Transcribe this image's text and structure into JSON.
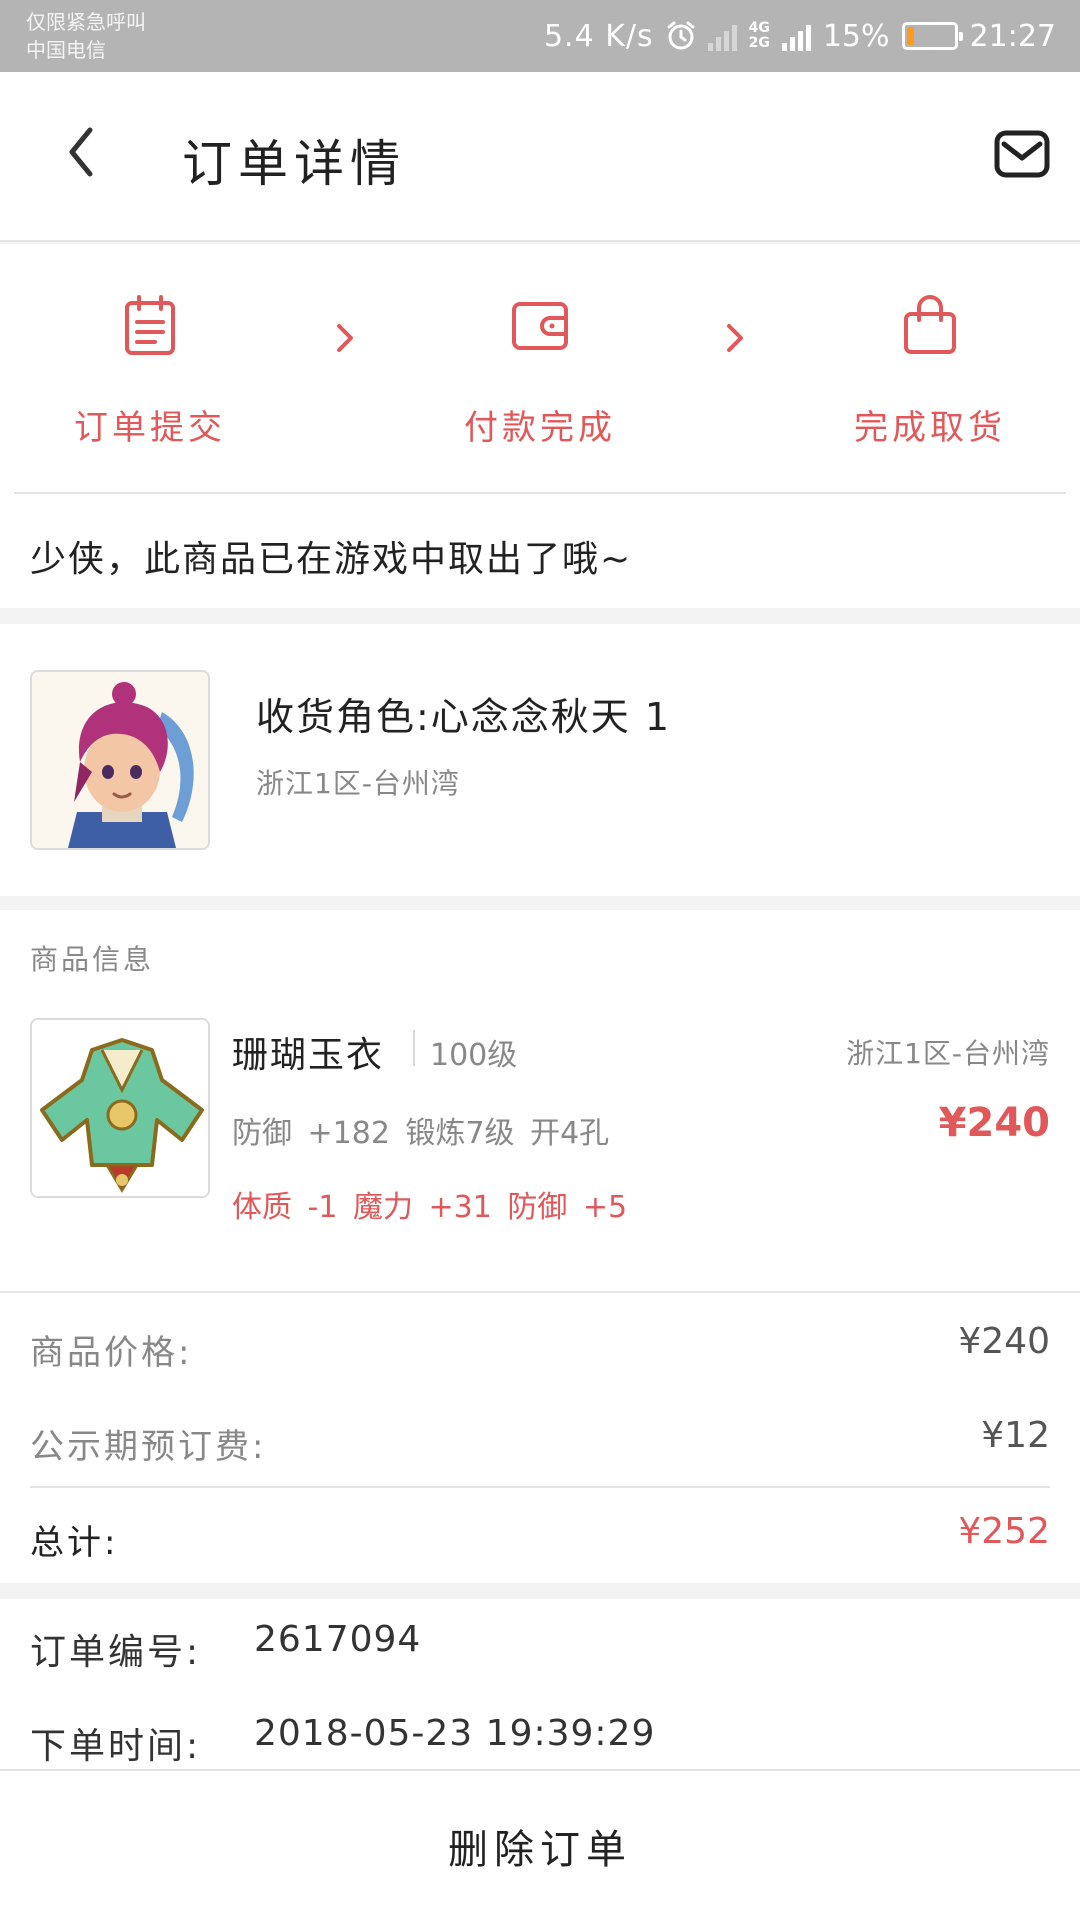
{
  "status_bar": {
    "line1": "仅限紧急呼叫",
    "line2": "中国电信",
    "net_speed": "5.4 K/s",
    "net_type_top": "4G",
    "net_type_bottom": "2G",
    "battery": "15%",
    "battery_level": 0.15,
    "time": "21:27",
    "icons": [
      "alarm-icon",
      "no-sim-signal-icon",
      "signal-icon",
      "battery-icon"
    ]
  },
  "header": {
    "title": "订单详情",
    "back_icon": "back-chevron-icon",
    "message_icon": "mail-icon"
  },
  "progress": {
    "accent": "#e0585a",
    "steps": [
      {
        "label": "订单提交",
        "icon": "clipboard-icon"
      },
      {
        "label": "付款完成",
        "icon": "wallet-icon"
      },
      {
        "label": "完成取货",
        "icon": "shopping-bag-icon"
      }
    ]
  },
  "notice": "少侠，此商品已在游戏中取出了哦~",
  "recipient": {
    "name": "收货角色:心念念秋天 1",
    "server": "浙江1区-台州湾"
  },
  "goods": {
    "section_title": "商品信息",
    "name": "珊瑚玉衣",
    "level": "100级",
    "server": "浙江1区-台州湾",
    "attributes": "防御 +182 锻炼7级 开4孔",
    "bonus": "体质 -1 魔力 +31 防御 +5",
    "price": "¥240"
  },
  "summary": {
    "rows": [
      {
        "label": "商品价格:",
        "value": "¥240"
      },
      {
        "label": "公示期预订费:",
        "value": "¥12"
      }
    ],
    "total_label": "总计:",
    "total_value": "¥252"
  },
  "order_info": {
    "rows": [
      {
        "label": "订单编号:",
        "value": "2617094"
      },
      {
        "label": "下单时间:",
        "value": "2018-05-23  19:39:29"
      }
    ]
  },
  "footer": {
    "delete_label": "删除订单"
  }
}
